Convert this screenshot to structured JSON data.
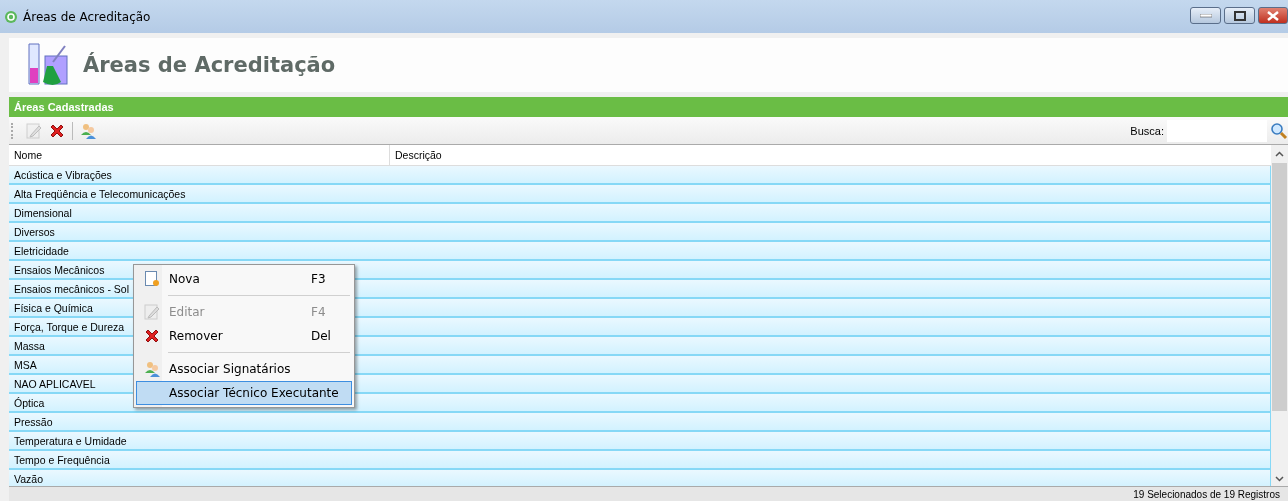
{
  "window": {
    "title": "Áreas de Acreditação"
  },
  "header": {
    "title": "Áreas de Acreditação"
  },
  "panel": {
    "title": "Áreas Cadastradas"
  },
  "toolbar": {
    "buttons": [
      {
        "kind": "edit",
        "disabled": true
      },
      {
        "kind": "remove",
        "disabled": false
      },
      {
        "kind": "people",
        "disabled": false
      }
    ],
    "search_label": "Busca:"
  },
  "table": {
    "columns": [
      "Nome",
      "Descrição"
    ],
    "rows": [
      {
        "nome": "Acústica e Vibrações",
        "selected": true
      },
      {
        "nome": "Alta Freqüência e Telecomunicações",
        "selected": true
      },
      {
        "nome": "Dimensional",
        "selected": true
      },
      {
        "nome": "Diversos",
        "selected": true
      },
      {
        "nome": "Eletricidade",
        "selected": true
      },
      {
        "nome": "Ensaios Mecânicos",
        "selected": true
      },
      {
        "nome": "Ensaios mecânicos - Sol",
        "selected": true
      },
      {
        "nome": "Física e Química",
        "selected": true
      },
      {
        "nome": "Força, Torque e Dureza",
        "selected": true
      },
      {
        "nome": "Massa",
        "selected": true
      },
      {
        "nome": "MSA",
        "selected": true
      },
      {
        "nome": "NAO APLICAVEL",
        "selected": true
      },
      {
        "nome": "Óptica",
        "selected": true
      },
      {
        "nome": "Pressão",
        "selected": true
      },
      {
        "nome": "Temperatura e Umidade",
        "selected": true
      },
      {
        "nome": "Tempo e Frequência",
        "selected": true
      },
      {
        "nome": "Vazão",
        "selected": true
      }
    ]
  },
  "context_menu": {
    "items": [
      {
        "kind": "new",
        "label": "Nova",
        "shortcut": "F3",
        "disabled": false,
        "selected": false
      },
      {
        "kind": "separator"
      },
      {
        "kind": "edit",
        "label": "Editar",
        "shortcut": "F4",
        "disabled": true,
        "selected": false
      },
      {
        "kind": "remove",
        "label": "Remover",
        "shortcut": "Del",
        "disabled": false,
        "selected": false
      },
      {
        "kind": "separator"
      },
      {
        "kind": "people",
        "label": "Associar Signatários",
        "disabled": false,
        "selected": false
      },
      {
        "kind": "plain",
        "label": "Associar Técnico Executante",
        "disabled": false,
        "selected": true
      }
    ]
  },
  "status_bar": {
    "text": "19 Selecionados de 19 Registros"
  }
}
